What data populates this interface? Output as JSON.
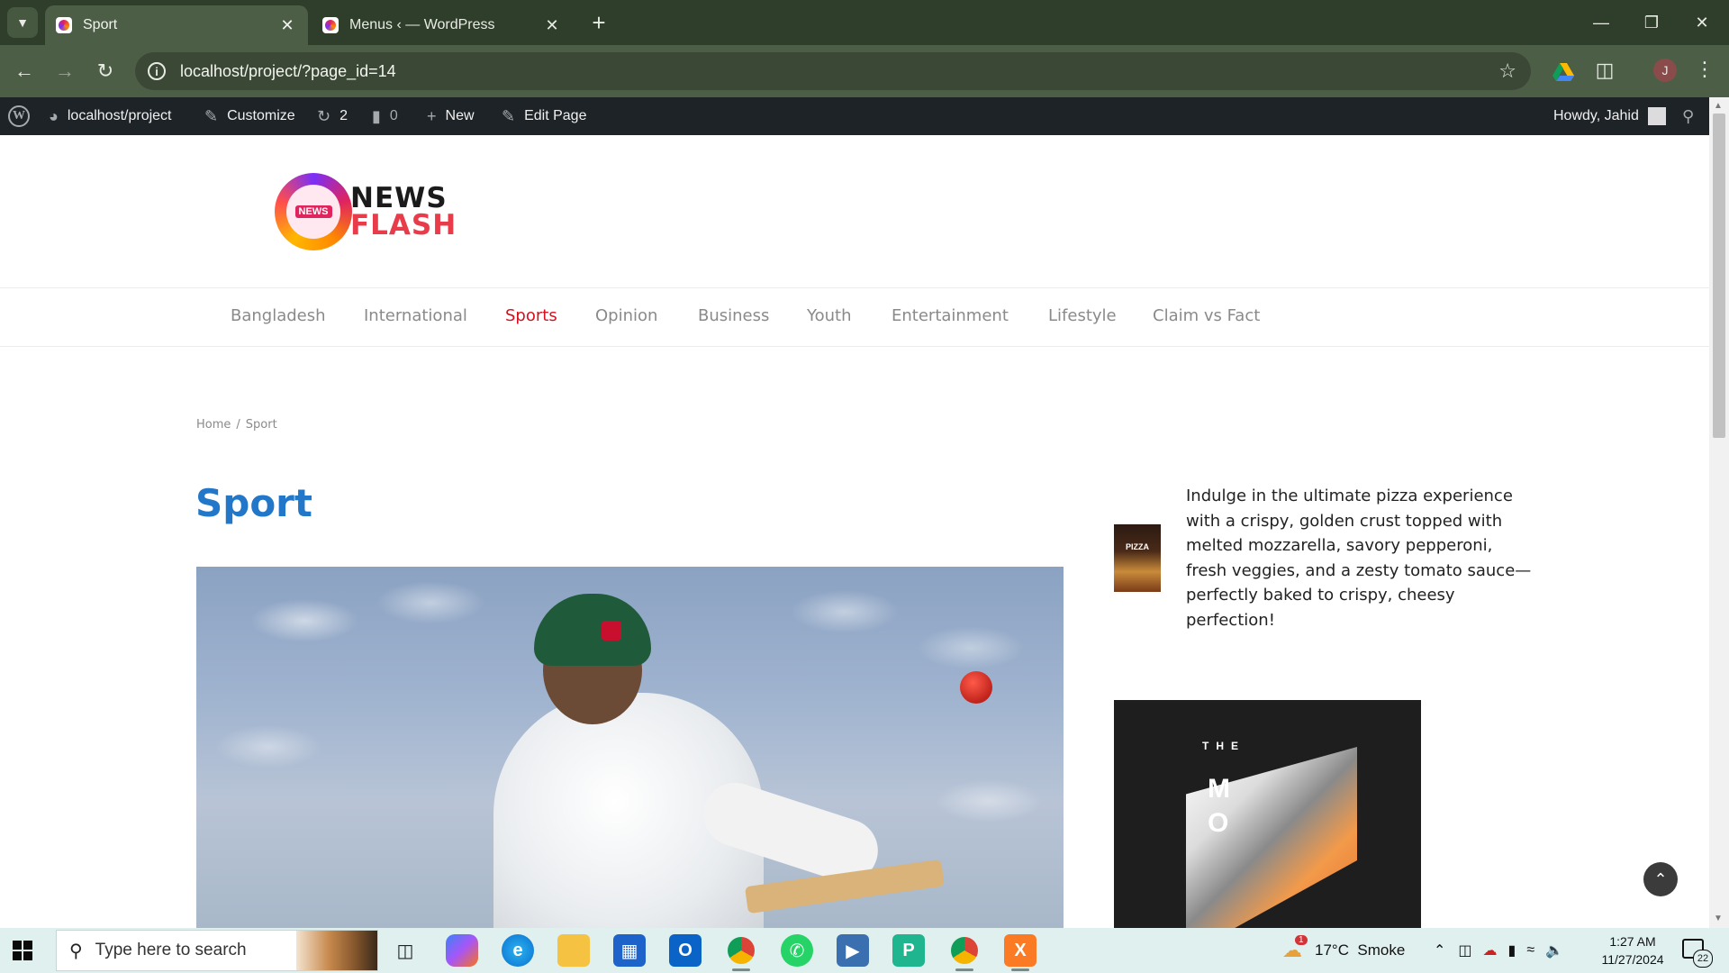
{
  "browser": {
    "tabs": [
      {
        "title": "Sport",
        "active": true
      },
      {
        "title": "Menus ‹ — WordPress",
        "active": false
      }
    ],
    "url": "localhost/project/?page_id=14",
    "profile_initial": "J",
    "icons": {
      "tab_list": "chevron-down-icon",
      "close": "close-icon",
      "new_tab": "plus-icon",
      "back": "arrow-left-icon",
      "forward": "arrow-right-icon",
      "reload": "reload-icon",
      "site_info": "info-icon",
      "bookmark": "star-icon",
      "extensions": "puzzle-icon",
      "menu": "kebab-menu-icon"
    }
  },
  "admin_bar": {
    "site_name": "localhost/project",
    "customize": "Customize",
    "updates_count": "2",
    "comments_count": "0",
    "new_label": "New",
    "edit_page": "Edit Page",
    "greeting": "Howdy, Jahid"
  },
  "site": {
    "logo": {
      "line1": "NEWS",
      "line2": "FLASH",
      "badge": "NEWS"
    },
    "nav": [
      {
        "label": "Bangladesh",
        "current": false
      },
      {
        "label": "International",
        "current": false
      },
      {
        "label": "Sports",
        "current": true
      },
      {
        "label": "Opinion",
        "current": false
      },
      {
        "label": "Business",
        "current": false
      },
      {
        "label": "Youth",
        "current": false
      },
      {
        "label": "Entertainment",
        "current": false
      },
      {
        "label": "Lifestyle",
        "current": false
      },
      {
        "label": "Claim vs Fact",
        "current": false
      }
    ],
    "accent_color": "#d6101e",
    "title_color": "#2277c9"
  },
  "content": {
    "breadcrumb": {
      "home": "Home",
      "separator": "/",
      "current": "Sport"
    },
    "page_title": "Sport"
  },
  "sidebar": {
    "ad_thumb_label": "PIZZA",
    "ad_text": "Indulge in the ultimate pizza experience with a crispy, golden crust topped with melted mozzarella, savory pepperoni, fresh veggies, and a zesty tomato sauce—perfectly baked to crispy, cheesy perfection!",
    "poster": {
      "top_word": "THE",
      "letters": "M\nO"
    }
  },
  "taskbar": {
    "search_placeholder": "Type here to search",
    "weather": "17°C  Smoke",
    "weather_alert": "1",
    "time": "1:27 AM",
    "date": "11/27/2024",
    "notifications": "22"
  }
}
